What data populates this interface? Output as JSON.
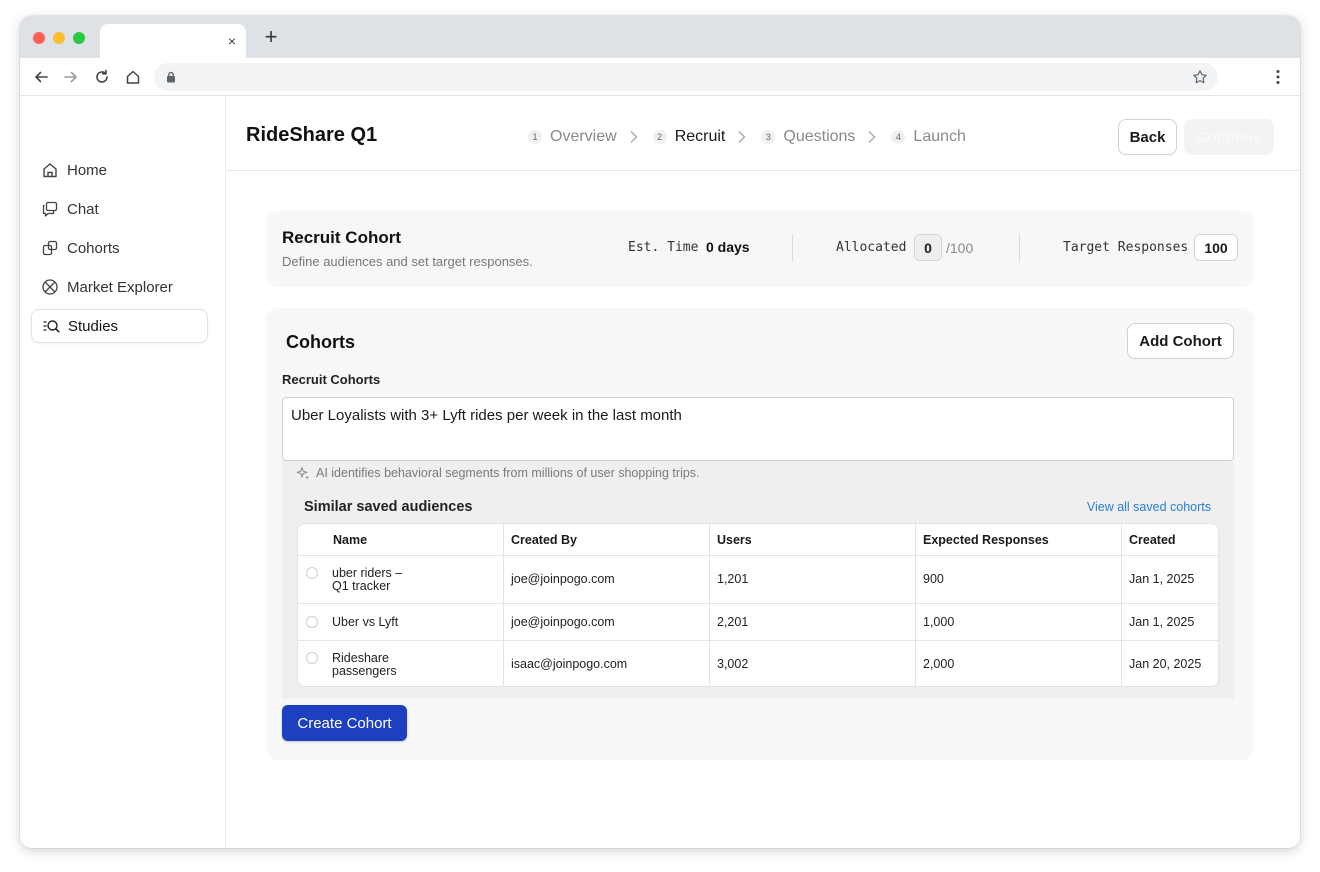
{
  "browser": {
    "tab_title": "",
    "tab_close_glyph": "×",
    "new_tab_glyph": "+",
    "address": "",
    "icons": [
      "back-arrow-icon",
      "forward-arrow-icon",
      "reload-icon",
      "home-icon",
      "lock-icon",
      "star-icon",
      "kebab-menu-icon"
    ]
  },
  "sidebar": {
    "items": [
      {
        "label": "Home",
        "icon": "home-icon",
        "active": false
      },
      {
        "label": "Chat",
        "icon": "chat-icon",
        "active": false
      },
      {
        "label": "Cohorts",
        "icon": "cohorts-icon",
        "active": false
      },
      {
        "label": "Market Explorer",
        "icon": "globe-icon",
        "active": false
      },
      {
        "label": "Studies",
        "icon": "studies-search-icon",
        "active": true
      }
    ]
  },
  "header": {
    "title": "RideShare Q1",
    "steps": [
      {
        "num": "1",
        "label": "Overview",
        "active": false
      },
      {
        "num": "2",
        "label": "Recruit",
        "active": true
      },
      {
        "num": "3",
        "label": "Questions",
        "active": false
      },
      {
        "num": "4",
        "label": "Launch",
        "active": false
      }
    ],
    "back_label": "Back",
    "continue_label": "Continue"
  },
  "recruit": {
    "title": "Recruit Cohort",
    "subtitle": "Define audiences and set target responses.",
    "est_time_label": "Est. Time",
    "est_time_value": "0 days",
    "allocated_label": "Allocated",
    "allocated_value": "0",
    "allocated_total": "/100",
    "target_label": "Target Responses",
    "target_value": "100"
  },
  "cohorts": {
    "title": "Cohorts",
    "add_label": "Add Cohort",
    "recruit_label": "Recruit Cohorts",
    "query": "Uber Loyalists with 3+ Lyft rides per week in the last month",
    "ai_note": "AI identifies behavioral segments from millions of user shopping trips.",
    "similar_title": "Similar saved audiences",
    "view_all": "View all saved cohorts",
    "columns": [
      "Name",
      "Created By",
      "Users",
      "Expected Responses",
      "Created"
    ],
    "rows": [
      {
        "name": [
          "uber riders –",
          "Q1 tracker"
        ],
        "created_by": "joe@joinpogo.com",
        "users": "1,201",
        "expected": "900",
        "created": "Jan 1, 2025"
      },
      {
        "name": [
          "Uber vs Lyft"
        ],
        "created_by": "joe@joinpogo.com",
        "users": "2,201",
        "expected": "1,000",
        "created": "Jan 1, 2025"
      },
      {
        "name": [
          "Rideshare",
          "passengers"
        ],
        "created_by": "isaac@joinpogo.com",
        "users": "3,002",
        "expected": "2,000",
        "created": "Jan 20, 2025"
      }
    ],
    "create_label": "Create Cohort"
  },
  "colors": {
    "primary_button": "#1e3fbf",
    "link": "#2a7fd4"
  }
}
